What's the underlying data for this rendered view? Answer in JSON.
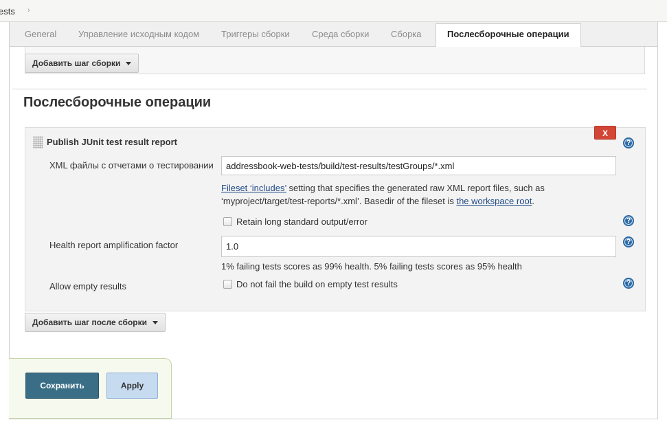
{
  "breadcrumb": {
    "current": "ests",
    "separator": "›"
  },
  "tabs": [
    {
      "label": "General"
    },
    {
      "label": "Управление исходным кодом"
    },
    {
      "label": "Триггеры сборки"
    },
    {
      "label": "Среда сборки"
    },
    {
      "label": "Сборка"
    },
    {
      "label": "Послесборочные операции",
      "active": true
    }
  ],
  "build_section": {
    "add_step_label": "Добавить шаг сборки"
  },
  "post_build": {
    "title": "Послесборочные операции",
    "add_step_label": "Добавить шаг после сборки",
    "step": {
      "title": "Publish JUnit test result report",
      "delete_label": "X",
      "xml_label": "XML файлы с отчетами о тестировании",
      "xml_value": "addressbook-web-tests/build/test-results/testGroups/*.xml",
      "xml_help": {
        "link1": "Fileset ‘includes’",
        "text1": " setting that specifies the generated raw XML report files, such as ‘myproject/target/test-reports/*.xml’. Basedir of the fileset is ",
        "link2": "the workspace root",
        "text2": "."
      },
      "retain_label": "Retain long standard output/error",
      "health_label": "Health report amplification factor",
      "health_value": "1.0",
      "health_help": "1% failing tests scores as 99% health. 5% failing tests scores as 95% health",
      "allow_empty_label": "Allow empty results",
      "allow_empty_check_label": "Do not fail the build on empty test results"
    }
  },
  "buttons": {
    "save": "Сохранить",
    "apply": "Apply"
  },
  "help_glyph": "?",
  "icons": {
    "help": "question-circle-icon",
    "drag": "drag-handle-icon",
    "caret": "caret-down-icon"
  },
  "colors": {
    "delete": "#d24636",
    "save": "#3a6e86",
    "apply": "#c6daf0",
    "help": "#2d6aa6",
    "link": "#204a87"
  }
}
